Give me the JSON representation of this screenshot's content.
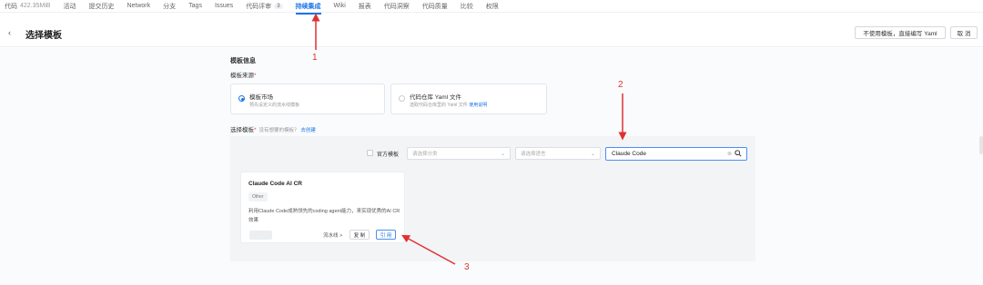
{
  "nav": {
    "items": [
      {
        "label": "代码",
        "sub": "422.35MiB"
      },
      {
        "label": "活动"
      },
      {
        "label": "提交历史"
      },
      {
        "label": "Network"
      },
      {
        "label": "分支"
      },
      {
        "label": "Tags"
      },
      {
        "label": "Issues"
      },
      {
        "label": "代码评审",
        "badge": "3"
      },
      {
        "label": "持续集成",
        "active": true
      },
      {
        "label": "Wiki"
      },
      {
        "label": "报表"
      },
      {
        "label": "代码洞察"
      },
      {
        "label": "代码质量"
      },
      {
        "label": "比较"
      },
      {
        "label": "权限"
      }
    ]
  },
  "header": {
    "title": "选择模板",
    "no_template_button": "不使用模板，直接编写 Yaml",
    "cancel_button": "取 消"
  },
  "template_info": {
    "section_title": "模板信息",
    "source_label": "模板来源",
    "source_options": [
      {
        "title": "模板市场",
        "desc": "预先设定义的流水线模板",
        "selected": true
      },
      {
        "title": "代码仓库 Yaml 文件",
        "desc": "选取代码仓库里的 Yaml 文件",
        "link": "使用说明",
        "selected": false
      }
    ],
    "select_label": "选择模板",
    "select_hint": "没有想要的模板？",
    "create_link": "去创建"
  },
  "filters": {
    "official_label": "官方模板",
    "category_placeholder": "请选择分类",
    "language_placeholder": "请选择语言",
    "search_value": "Claude Code"
  },
  "templates": [
    {
      "name": "Claude Code AI CR",
      "tag": "Other",
      "desc": "利用Claude Code成熟领先的coding agent能力，来实现优秀的AI CR效果",
      "pipeline_link": "流水线 >",
      "copy_button": "复 制",
      "use_button": "引 用"
    }
  ],
  "annotations": {
    "mark1": "1",
    "mark2": "2",
    "mark3": "3",
    "color": "#e03131"
  },
  "colors": {
    "accent": "#1a73e8",
    "annotation": "#e03131"
  }
}
